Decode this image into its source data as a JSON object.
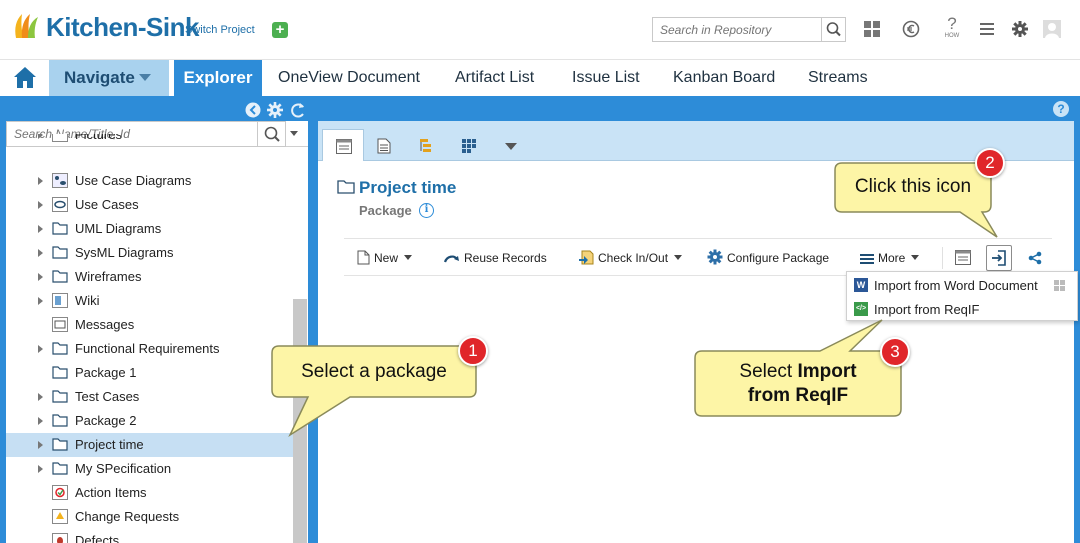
{
  "header": {
    "brand": "Kitchen-Sink",
    "switch_project": "Switch Project",
    "add_icon": "plus-square-icon",
    "search_placeholder": "Search in Repository",
    "icons": [
      "grid-icon",
      "euro-circle-icon",
      "how-question-icon",
      "menu-icon",
      "gear-icon",
      "user-avatar-icon"
    ],
    "how_label": "HOW"
  },
  "nav": {
    "home_icon": "home-icon",
    "items": [
      "Navigate",
      "Explorer",
      "OneView Document",
      "Artifact List",
      "Issue List",
      "Kanban Board",
      "Streams"
    ],
    "active": "Explorer"
  },
  "tree": {
    "search_placeholder": "Search Name/Title, Id",
    "items": [
      {
        "label": "Pictures",
        "expandable": true
      },
      {
        "label": "Use Case Diagrams",
        "expandable": true
      },
      {
        "label": "Use Cases",
        "expandable": true
      },
      {
        "label": "UML Diagrams",
        "expandable": true
      },
      {
        "label": "SysML Diagrams",
        "expandable": true
      },
      {
        "label": "Wireframes",
        "expandable": true
      },
      {
        "label": "Wiki",
        "expandable": true
      },
      {
        "label": "Messages",
        "expandable": false
      },
      {
        "label": "Functional Requirements",
        "expandable": true
      },
      {
        "label": "Package 1",
        "expandable": false
      },
      {
        "label": "Test Cases",
        "expandable": true
      },
      {
        "label": "Package 2",
        "expandable": true
      },
      {
        "label": "Project time",
        "expandable": true,
        "selected": true
      },
      {
        "label": "My SPecification",
        "expandable": true
      },
      {
        "label": "Action Items",
        "expandable": false
      },
      {
        "label": "Change Requests",
        "expandable": false
      },
      {
        "label": "Defects",
        "expandable": false
      }
    ]
  },
  "package": {
    "title": "Project time",
    "type": "Package"
  },
  "actions": {
    "new": "New",
    "reuse": "Reuse Records",
    "checkin": "Check In/Out",
    "configure": "Configure Package",
    "more": "More"
  },
  "dropdown": {
    "items": [
      "Import from Word Document",
      "Import from ReqIF"
    ]
  },
  "callouts": {
    "c1": {
      "num": "1",
      "text": "Select a package"
    },
    "c2": {
      "num": "2",
      "text": "Click this icon"
    },
    "c3": {
      "num": "3",
      "prefix": "Select ",
      "bold1": "Import",
      "bold2": "from ReqIF"
    }
  },
  "colors": {
    "brand": "#1e6fa8",
    "frame": "#2d8cd8",
    "callout_fill": "#fdf5a6",
    "callout_number": "#e0262a",
    "selection": "#c6dff3"
  }
}
